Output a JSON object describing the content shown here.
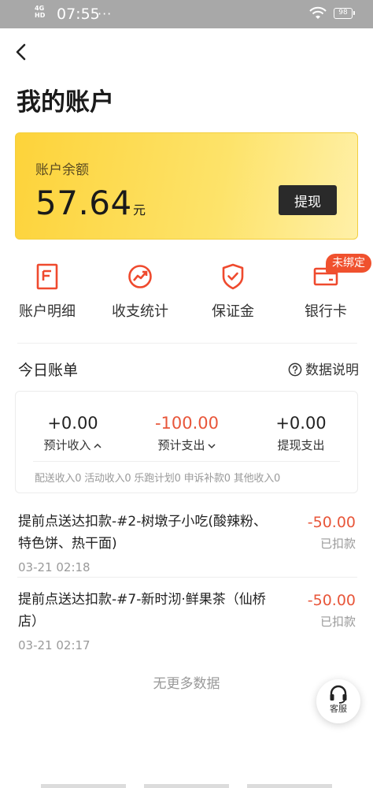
{
  "status_bar": {
    "network": "4G",
    "network_sub": "HD",
    "time": "07:55",
    "dots": "···",
    "battery": "98"
  },
  "header": {
    "title": "我的账户"
  },
  "balance": {
    "label": "账户余额",
    "amount": "57.64",
    "unit": "元",
    "withdraw_label": "提现"
  },
  "entries": [
    {
      "label": "账户明细",
      "icon": "document-icon"
    },
    {
      "label": "收支统计",
      "icon": "trend-chart-icon"
    },
    {
      "label": "保证金",
      "icon": "shield-check-icon"
    },
    {
      "label": "银行卡",
      "icon": "bank-card-icon",
      "badge": "未绑定"
    }
  ],
  "today": {
    "title": "今日账单",
    "explain_label": "数据说明",
    "stats": [
      {
        "value": "+0.00",
        "label": "预计收入",
        "toggle": "chevron-up-icon"
      },
      {
        "value": "-100.00",
        "label": "预计支出",
        "toggle": "chevron-down-icon"
      },
      {
        "value": "+0.00",
        "label": "提现支出"
      }
    ],
    "detail": "配送收入0 活动收入0 乐跑计划0 申诉补款0 其他收入0"
  },
  "bills": [
    {
      "desc": "提前点送达扣款-#2-树墩子小吃(酸辣粉、特色饼、热干面)",
      "time": "03-21 02:18",
      "amount": "-50.00",
      "status": "已扣款"
    },
    {
      "desc": "提前点送达扣款-#7-新时沏·鲜果茶（仙桥店）",
      "time": "03-21 02:17",
      "amount": "-50.00",
      "status": "已扣款"
    }
  ],
  "footer": {
    "no_more": "无更多数据",
    "support_label": "客服"
  },
  "colors": {
    "accent_yellow": "#fdd33a",
    "negative": "#e8563a",
    "badge": "#f0512e",
    "icon_red": "#ef4a2e"
  }
}
